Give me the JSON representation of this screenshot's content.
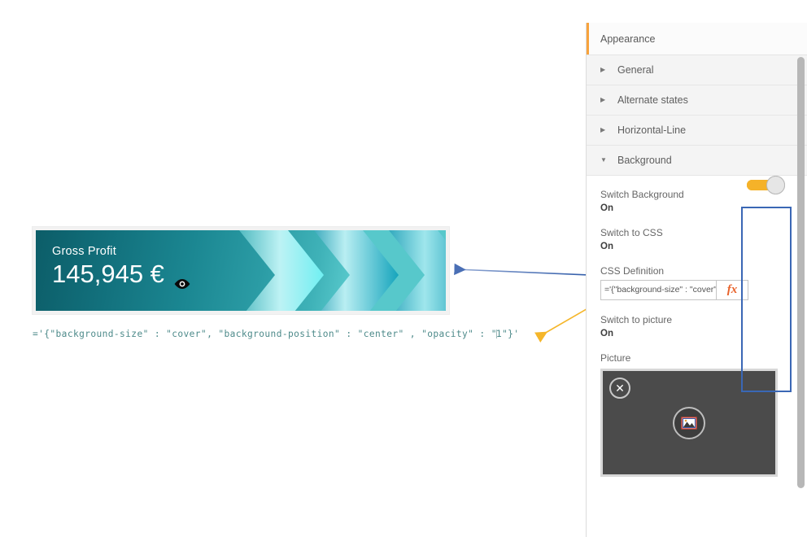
{
  "kpi": {
    "title": "Gross Profit",
    "value": "145,945 €",
    "eye_icon": "eye-icon",
    "gradient_from": "#0c5d68",
    "gradient_to": "#57c8cb",
    "chevron_light": "#7ff0f2",
    "chevron_mid": "#0fa6bd"
  },
  "code_annotation": {
    "prefix": "='{\"background-size\" : \"cover\", \"background-position\" : \"center\" , \"opacity\" : \"",
    "opacity_value": "1",
    "suffix": "\"}'",
    "color": "#4d8a8a"
  },
  "arrows": {
    "blue": {
      "color": "#4a6fb5",
      "label": "blue-arrow-to-kpi"
    },
    "orange": {
      "color": "#f5b62a",
      "label": "orange-arrow-to-opacity"
    }
  },
  "panel": {
    "header": "Appearance",
    "accent_color": "#f8a33c",
    "accordion": [
      {
        "label": "General",
        "expanded": false,
        "triangle": "▶"
      },
      {
        "label": "Alternate states",
        "expanded": false,
        "triangle": "▶"
      },
      {
        "label": "Horizontal-Line",
        "expanded": false,
        "triangle": "▶"
      },
      {
        "label": "Background",
        "expanded": true,
        "triangle": "▼"
      }
    ],
    "background_section": {
      "switch_background": {
        "label": "Switch Background",
        "state": "On",
        "on": true
      },
      "switch_to_css": {
        "label": "Switch to CSS",
        "state": "On",
        "on": true
      },
      "css_definition": {
        "label": "CSS Definition",
        "value": "='{\"background-size\" : \"cover\"",
        "fx_label": "fx"
      },
      "switch_to_picture": {
        "label": "Switch to picture",
        "state": "On",
        "on": true
      },
      "picture": {
        "label": "Picture",
        "close_icon": "✕",
        "placeholder_icon": "image-icon"
      }
    },
    "toggle_on_color": "#f5b229",
    "highlight_box_color": "#3a67b5"
  }
}
